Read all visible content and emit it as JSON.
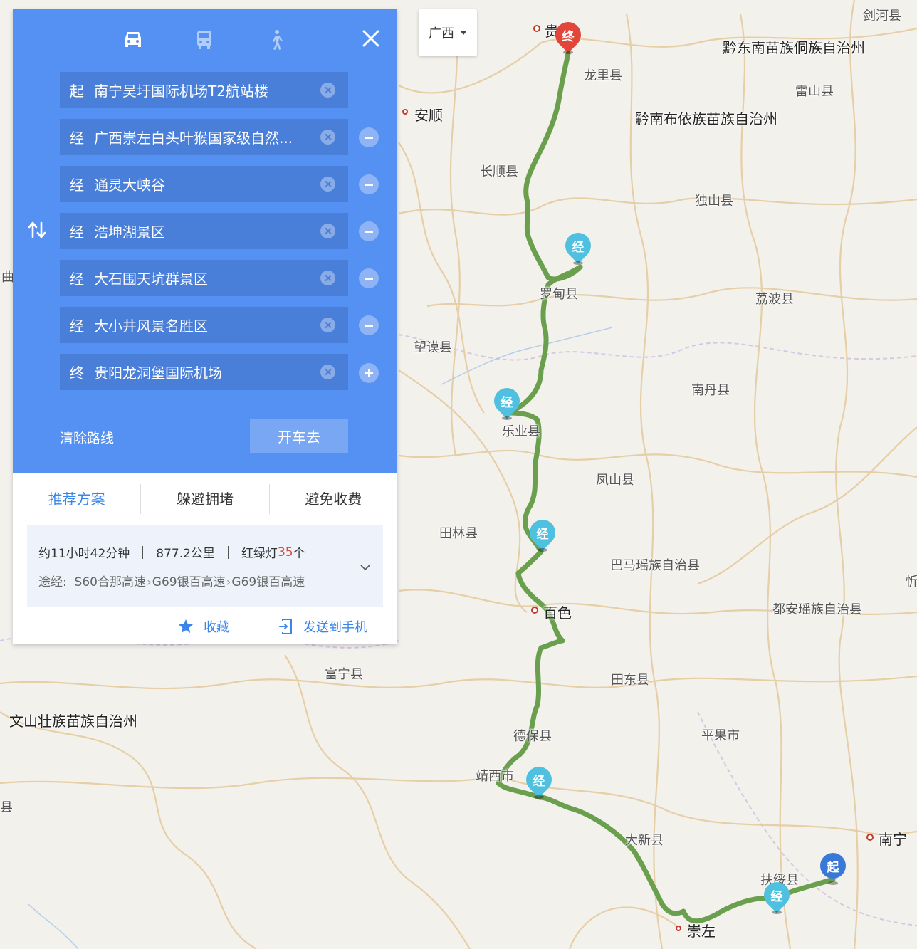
{
  "region_selector": {
    "label": "广西"
  },
  "transport_modes": [
    {
      "name": "drive",
      "icon": "car-icon",
      "active": true
    },
    {
      "name": "bus",
      "icon": "bus-icon",
      "active": false
    },
    {
      "name": "walk",
      "icon": "walk-icon",
      "active": false
    }
  ],
  "waypoints": [
    {
      "prefix": "起",
      "name": "南宁吴圩国际机场T2航站楼",
      "action": "none"
    },
    {
      "prefix": "经",
      "name": "广西崇左白头叶猴国家级自然...",
      "action": "remove"
    },
    {
      "prefix": "经",
      "name": "通灵大峡谷",
      "action": "remove"
    },
    {
      "prefix": "经",
      "name": "浩坤湖景区",
      "action": "remove"
    },
    {
      "prefix": "经",
      "name": "大石围天坑群景区",
      "action": "remove"
    },
    {
      "prefix": "经",
      "name": "大小井风景名胜区",
      "action": "remove"
    },
    {
      "prefix": "终",
      "name": "贵阳龙洞堡国际机场",
      "action": "add"
    }
  ],
  "clear_route_label": "清除路线",
  "drive_button_label": "开车去",
  "route_tabs": [
    {
      "label": "推荐方案",
      "active": true
    },
    {
      "label": "躲避拥堵",
      "active": false
    },
    {
      "label": "避免收费",
      "active": false
    }
  ],
  "summary": {
    "duration": "约11小时42分钟",
    "distance": "877.2公里",
    "lights_prefix": "红绿灯",
    "lights_count": "35",
    "lights_suffix": "个",
    "via_label": "途经:",
    "via_roads": [
      "S60合那高速",
      "G69银百高速",
      "G69银百高速"
    ]
  },
  "actions": {
    "favorite": "收藏",
    "send_to_phone": "发送到手机"
  },
  "markers": {
    "start": "起",
    "via": "经",
    "end": "终"
  },
  "map_labels": [
    "剑河县",
    "贵阳",
    "黔东南苗族侗族自治州",
    "龙里县",
    "雷山县",
    "安顺",
    "黔南布依族苗族自治州",
    "长顺县",
    "独山县",
    "罗甸县",
    "荔波县",
    "望谟县",
    "南丹县",
    "乐业县",
    "凤山县",
    "田林县",
    "巴马瑶族自治县",
    "百色",
    "都安瑶族自治县",
    "富宁县",
    "田东县",
    "文山壮族苗族自治州",
    "德保县",
    "平果市",
    "靖西市",
    "大新县",
    "南宁",
    "扶绥县",
    "崇左",
    "曲",
    "县",
    "忻"
  ],
  "colors": {
    "panel_blue": "#5591f2",
    "row_blue": "#4a7fd9",
    "accent_blue": "#3a86e8",
    "route_green": "#6a9f4e",
    "lights_red": "#e2463a",
    "via_marker": "#4fc0e0",
    "end_marker": "#e2463a",
    "start_marker": "#3a78d8"
  }
}
